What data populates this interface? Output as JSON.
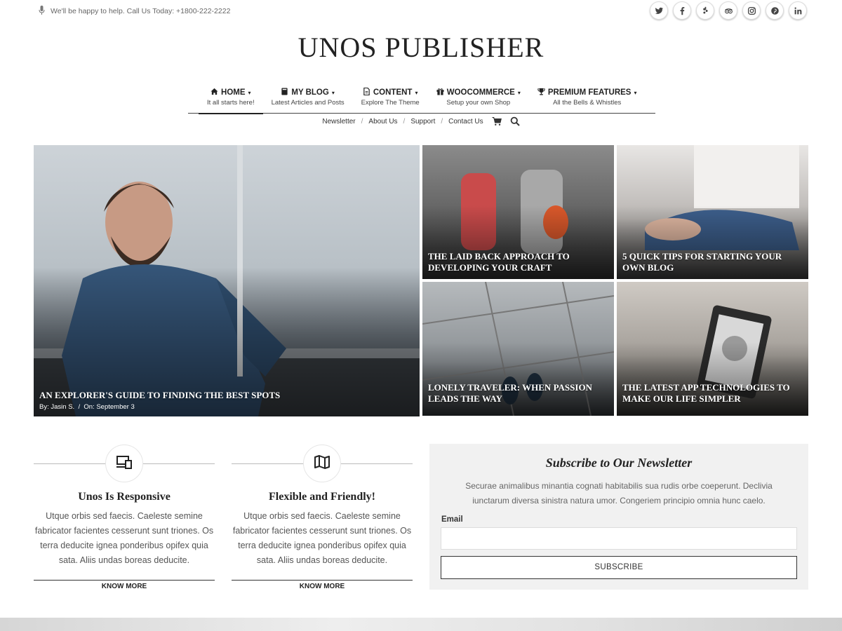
{
  "topbar": {
    "help_text": "We'll be happy to help. Call Us Today: +1800-222-2222",
    "socials": [
      "twitter-icon",
      "facebook-icon",
      "yelp-icon",
      "tripadvisor-icon",
      "instagram-icon",
      "pinterest-icon",
      "linkedin-icon"
    ]
  },
  "logo": "UNOS PUBLISHER",
  "nav": [
    {
      "label": "HOME",
      "sub": "It all starts here!",
      "icon": "home-icon"
    },
    {
      "label": "MY BLOG",
      "sub": "Latest Articles and Posts",
      "icon": "book-icon"
    },
    {
      "label": "CONTENT",
      "sub": "Explore The Theme",
      "icon": "file-icon"
    },
    {
      "label": "WOOCOMMERCE",
      "sub": "Setup your own Shop",
      "icon": "gift-icon"
    },
    {
      "label": "PREMIUM FEATURES",
      "sub": "All the Bells & Whistles",
      "icon": "trophy-icon"
    }
  ],
  "secnav": [
    "Newsletter",
    "About Us",
    "Support",
    "Contact Us"
  ],
  "hero": {
    "main": {
      "title": "AN EXPLORER'S GUIDE TO FINDING THE BEST SPOTS",
      "by_label": "By:",
      "author": "Jasin S.",
      "on_label": "On:",
      "date": "September 3"
    },
    "tiles": [
      "THE LAID BACK APPROACH TO DEVELOPING YOUR CRAFT",
      "5 QUICK TIPS FOR STARTING YOUR OWN BLOG",
      "LONELY TRAVELER: WHEN PASSION LEADS THE WAY",
      "THE LATEST APP TECHNOLOGIES TO MAKE OUR LIFE SIMPLER"
    ]
  },
  "features": [
    {
      "title": "Unos Is Responsive",
      "text": "Utque orbis sed faecis. Caeleste semine fabricator facientes cesserunt sunt triones. Os terra deducite ignea ponderibus opifex quia sata. Aliis undas boreas deducite.",
      "button": "KNOW MORE",
      "icon": "devices-icon"
    },
    {
      "title": "Flexible and Friendly!",
      "text": "Utque orbis sed faecis. Caeleste semine fabricator facientes cesserunt sunt triones. Os terra deducite ignea ponderibus opifex quia sata. Aliis undas boreas deducite.",
      "button": "KNOW MORE",
      "icon": "map-icon"
    }
  ],
  "newsletter": {
    "title": "Subscribe to Our Newsletter",
    "text": "Securae animalibus minantia cognati habitabilis sua rudis orbe coeperunt. Declivia iunctarum diversa sinistra natura umor. Congeriem principio omnia hunc caelo.",
    "email_label": "Email",
    "email_value": "",
    "button": "SUBSCRIBE"
  }
}
